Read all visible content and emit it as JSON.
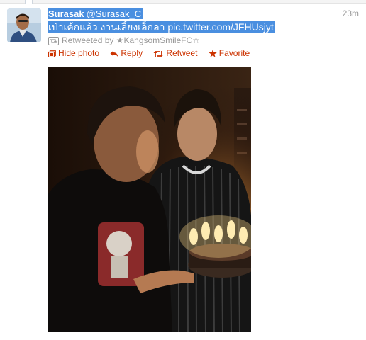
{
  "tweet": {
    "avatar_icon": "user-avatar",
    "fullname": "Surasak",
    "screen_name": "@Surasak_C",
    "time": "23m",
    "text": "เป่าเค้กแล้ว งานเลี้ยงเล็กลา pic.twitter.com/JFHUsjyt",
    "retweeted_by": "Retweeted by ★KangsomSmileFC☆",
    "actions": {
      "hide_photo": "Hide photo",
      "reply": "Reply",
      "retweet": "Retweet",
      "favorite": "Favorite"
    },
    "photo_icon": "birthday-cake-photo"
  },
  "colors": {
    "highlight": "#4a8fe0",
    "action": "#cc3300",
    "muted": "#999999"
  }
}
